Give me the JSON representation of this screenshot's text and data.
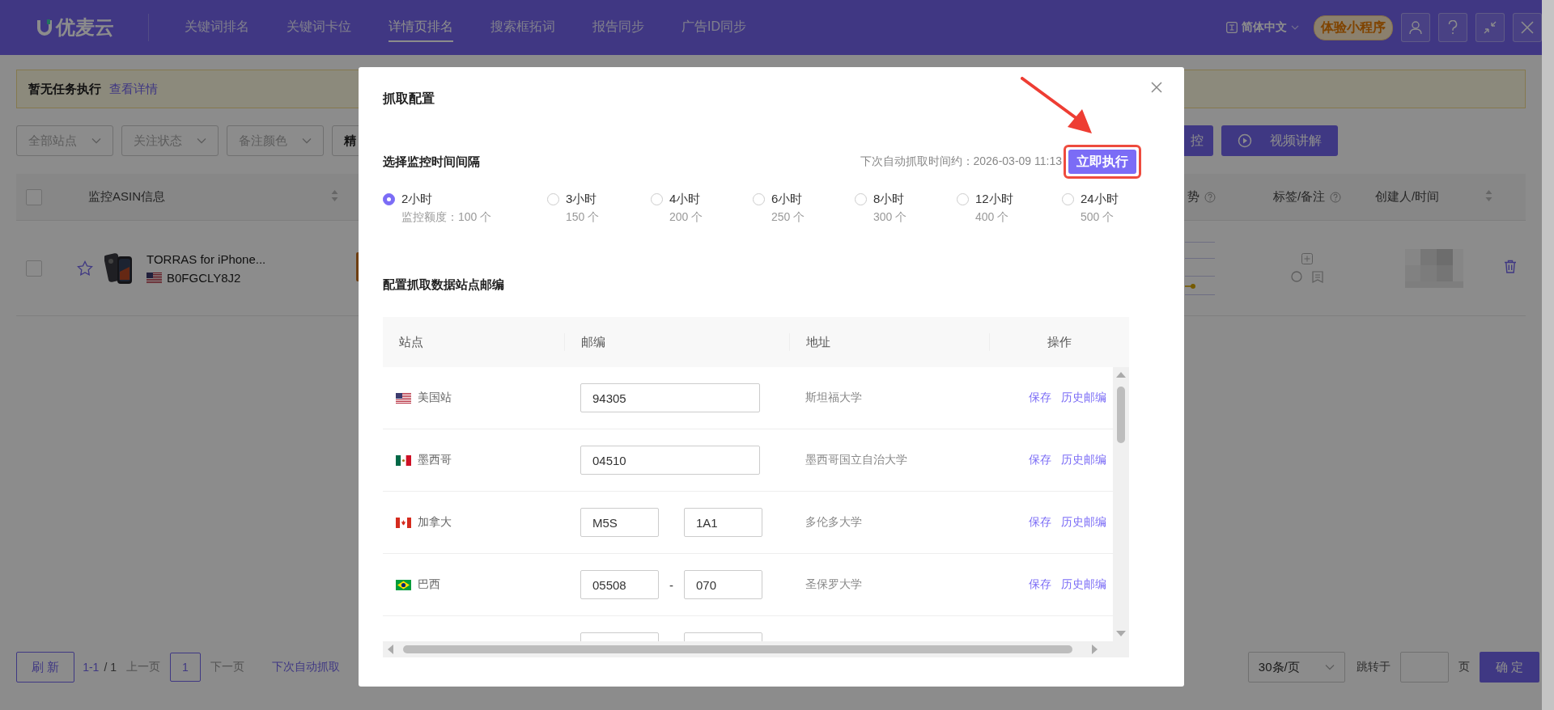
{
  "nav": {
    "logo": "优麦云",
    "items": [
      {
        "label": "关键词排名",
        "selected": false
      },
      {
        "label": "关键词卡位",
        "selected": false
      },
      {
        "label": "详情页排名",
        "selected": true
      },
      {
        "label": "搜索框拓词",
        "selected": false
      },
      {
        "label": "报告同步",
        "selected": false
      },
      {
        "label": "广告ID同步",
        "selected": false
      }
    ],
    "language": "简体中文",
    "mini_program": "体验小程序"
  },
  "notice": {
    "text": "暂无任务执行",
    "link": "查看详情"
  },
  "filters": [
    {
      "text": "全部站点",
      "kind": "select"
    },
    {
      "text": "关注状态",
      "kind": "select"
    },
    {
      "text": "备注颜色",
      "kind": "select"
    },
    {
      "text": "精",
      "kind": "value"
    }
  ],
  "actions": [
    {
      "label": "控",
      "kind": "primary"
    },
    {
      "label": "视频讲解",
      "kind": "video"
    }
  ],
  "table": {
    "select_all_checked": false,
    "columns": [
      {
        "label": "监控ASIN信息",
        "sortable": true,
        "help": false
      },
      {
        "label": "势",
        "sortable": false,
        "help": true
      },
      {
        "label": "标签/备注",
        "sortable": false,
        "help": true
      },
      {
        "label": "创建人/时间",
        "sortable": true,
        "help": false
      }
    ],
    "rows": [
      {
        "title": "TORRAS for iPhone...",
        "asin": "B0FGCLY8J2",
        "starred": false,
        "checked": false
      }
    ]
  },
  "pager": {
    "refresh": "刷 新",
    "range": "1-1",
    "total": "/ 1",
    "prev": "上一页",
    "page": "1",
    "next": "下一页",
    "next_crawl": "下次自动抓取",
    "page_size": "30条/页",
    "jump": "跳转于",
    "page_unit": "页",
    "confirm": "确 定"
  },
  "dialog": {
    "title": "抓取配置",
    "interval_heading": "选择监控时间间隔",
    "next_time": "下次自动抓取时间约：2026-03-09 11:13",
    "run_now": "立即执行",
    "intervals": [
      {
        "label": "2小时",
        "quota": "监控额度：100 个",
        "selected": true
      },
      {
        "label": "3小时",
        "quota": "150 个",
        "selected": false
      },
      {
        "label": "4小时",
        "quota": "200 个",
        "selected": false
      },
      {
        "label": "6小时",
        "quota": "250 个",
        "selected": false
      },
      {
        "label": "8小时",
        "quota": "300 个",
        "selected": false
      },
      {
        "label": "12小时",
        "quota": "400 个",
        "selected": false
      },
      {
        "label": "24小时",
        "quota": "500 个",
        "selected": false
      }
    ],
    "zip_heading": "配置抓取数据站点邮编",
    "zip_table": {
      "columns": [
        "站点",
        "邮编",
        "地址",
        "操作"
      ],
      "rows": [
        {
          "site": "美国站",
          "postcodes": [
            "94305"
          ],
          "address": "斯坦福大学",
          "actions": [
            "保存",
            "历史邮编"
          ]
        },
        {
          "site": "墨西哥",
          "postcodes": [
            "04510"
          ],
          "address": "墨西哥国立自治大学",
          "actions": [
            "保存",
            "历史邮编"
          ]
        },
        {
          "site": "加拿大",
          "postcodes": [
            "M5S",
            "1A1"
          ],
          "address": "多伦多大学",
          "actions": [
            "保存",
            "历史邮编"
          ]
        },
        {
          "site": "巴西",
          "postcodes": [
            "05508",
            "070"
          ],
          "separator": "-",
          "address": "圣保罗大学",
          "actions": [
            "保存",
            "历史邮编"
          ]
        }
      ]
    }
  }
}
